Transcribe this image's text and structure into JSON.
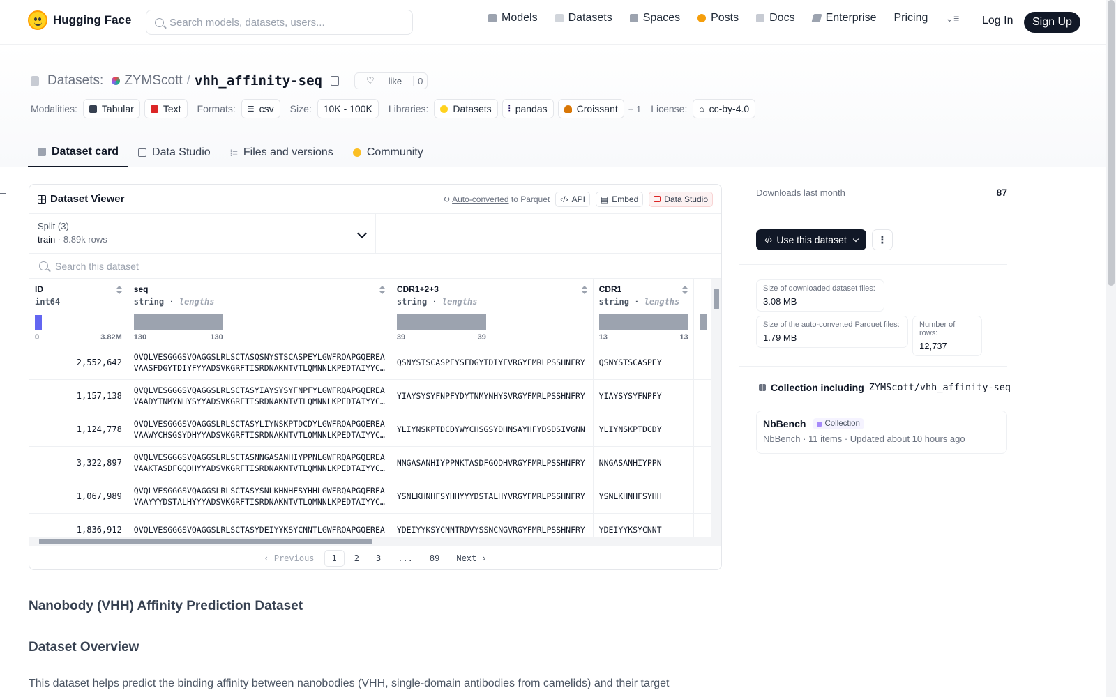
{
  "nav": {
    "brand": "Hugging Face",
    "search_placeholder": "Search models, datasets, users...",
    "links": [
      {
        "label": "Models",
        "icon": "models-icon",
        "color": "#9ca3af"
      },
      {
        "label": "Datasets",
        "icon": "datasets-icon",
        "color": "#9ca3af"
      },
      {
        "label": "Spaces",
        "icon": "spaces-icon",
        "color": "#9ca3af"
      },
      {
        "label": "Posts",
        "icon": "posts-icon",
        "color": "#f59e0b"
      },
      {
        "label": "Docs",
        "icon": "docs-icon",
        "color": "#9ca3af"
      },
      {
        "label": "Enterprise",
        "icon": "enterprise-icon",
        "color": "#9ca3af"
      },
      {
        "label": "Pricing",
        "icon": "",
        "color": ""
      }
    ],
    "login": "Log In",
    "signup": "Sign Up"
  },
  "header": {
    "section": "Datasets:",
    "owner": "ZYMScott",
    "slash": "/",
    "name": "vhh_affinity-seq",
    "like_label": "like",
    "like_count": "0",
    "modalities_label": "Modalities:",
    "modalities": [
      "Tabular",
      "Text"
    ],
    "formats_label": "Formats:",
    "formats": [
      "csv"
    ],
    "size_label": "Size:",
    "size": "10K - 100K",
    "libraries_label": "Libraries:",
    "libraries": [
      "Datasets",
      "pandas",
      "Croissant"
    ],
    "libraries_more": "+ 1",
    "license_label": "License:",
    "license": "cc-by-4.0"
  },
  "tabs": [
    {
      "label": "Dataset card",
      "active": true
    },
    {
      "label": "Data Studio",
      "active": false
    },
    {
      "label": "Files and versions",
      "active": false
    },
    {
      "label": "Community",
      "active": false
    }
  ],
  "viewer": {
    "title": "Dataset Viewer",
    "auto_converted": "Auto-converted",
    "to_parquet": "to Parquet",
    "api": "API",
    "embed": "Embed",
    "data_studio": "Data Studio",
    "split_label": "Split (3)",
    "split_name": "train",
    "split_rows": "8.89k rows",
    "search_placeholder": "Search this dataset",
    "columns": [
      {
        "name": "ID",
        "type": "int64",
        "kind": "",
        "min": "0",
        "max": "3.82M"
      },
      {
        "name": "seq",
        "type": "string",
        "kind": "lengths",
        "min": "130",
        "max": "130"
      },
      {
        "name": "CDR1+2+3",
        "type": "string",
        "kind": "lengths",
        "min": "39",
        "max": "39"
      },
      {
        "name": "CDR1",
        "type": "string",
        "kind": "lengths",
        "min": "13",
        "max": "13"
      }
    ],
    "rows": [
      {
        "id": "2,552,642",
        "seq1": "QVQLVESGGGSVQAGGSLRLSCTASQSNYSTSCASPEYLGWFRQAPGQEREA",
        "seq2": "VAASFDGYTDIYFYYADSVKGRFTISRDNAKNTVTLQMNNLKPEDTAIYYC…",
        "cdr123": "QSNYSTSCASPEYSFDGYTDIYFVRGYFMRLPSSHNFRY",
        "cdr1": "QSNYSTSCASPEY"
      },
      {
        "id": "1,157,138",
        "seq1": "QVQLVESGGGSVQAGGSLRLSCTASYIAYSYSYFNPFYLGWFRQAPGQEREA",
        "seq2": "VAADYTNMYNHYSYYADSVKGRFTISRDNAKNTVTLQMNNLKPEDTAIYYC…",
        "cdr123": "YIAYSYSYFNPFYDYTNMYNHYSVRGYFMRLPSSHNFRY",
        "cdr1": "YIAYSYSYFNPFY"
      },
      {
        "id": "1,124,778",
        "seq1": "QVQLVESGGGSVQAGGSLRLSCTASYLIYNSKPTDCDYLGWFRQAPGQEREA",
        "seq2": "VAAWYCHSGSYDHYYADSVKGRFTISRDNAKNTVTLQMNNLKPEDTAIYYC…",
        "cdr123": "YLIYNSKPTDCDYWYCHSGSYDHNSAYHFYDSDSIVGNN",
        "cdr1": "YLIYNSKPTDCDY"
      },
      {
        "id": "3,322,897",
        "seq1": "QVQLVESGGGSVQAGGSLRLSCTASNNGASANHIYPPNLGWFRQAPGQEREA",
        "seq2": "VAAKTASDFGQDHYYADSVKGRFTISRDNAKNTVTLQMNNLKPEDTAIYYC…",
        "cdr123": "NNGASANHIYPPNKTASDFGQDHVRGYFMRLPSSHNFRY",
        "cdr1": "NNGASANHIYPPN"
      },
      {
        "id": "1,067,989",
        "seq1": "QVQLVESGGGSVQAGGSLRLSCTASYSNLKHNHFSYHHLGWFRQAPGQEREA",
        "seq2": "VAAYYYDSTALHYYYADSVKGRFTISRDNAKNTVTLQMNNLKPEDTAIYYC…",
        "cdr123": "YSNLKHNHFSYHHYYYDSTALHYVRGYFMRLPSSHNFRY",
        "cdr1": "YSNLKHNHFSYHH"
      },
      {
        "id": "1,836,912",
        "seq1": "QVQLVESGGGSVQAGGSLRLSCTASYDEIYYKSYCNNTLGWFRQAPGQEREA",
        "seq2": "",
        "cdr123": "YDEIYYKSYCNNTRDVYSSNCNGVRGYFMRLPSSHNFRY",
        "cdr1": "YDEIYYKSYCNNT"
      }
    ],
    "pager": {
      "prev": "Previous",
      "pages": [
        "1",
        "2",
        "3",
        "...",
        "89"
      ],
      "next": "Next"
    }
  },
  "card": {
    "h1": "Nanobody (VHH) Affinity Prediction Dataset",
    "h2": "Dataset Overview",
    "para": "This dataset helps predict the binding affinity between nanobodies (VHH, single-domain antibodies from camelids) and their target"
  },
  "sidebar": {
    "downloads_label": "Downloads last month",
    "downloads": "87",
    "use_dataset": "Use this dataset",
    "more": "⋮",
    "stats": [
      {
        "label": "Size of downloaded dataset files:",
        "value": "3.08 MB"
      },
      {
        "label": "Size of the auto-converted Parquet files:",
        "value": "1.79 MB"
      },
      {
        "label": "Number of rows:",
        "value": "12,737"
      }
    ],
    "collection_title": "Collection including",
    "collection_repo": "ZYMScott/vhh_affinity-seq",
    "collection": {
      "name": "NbBench",
      "badge": "Collection",
      "owner": "NbBench",
      "items": "11 items",
      "updated": "Updated about 10 hours ago"
    }
  }
}
